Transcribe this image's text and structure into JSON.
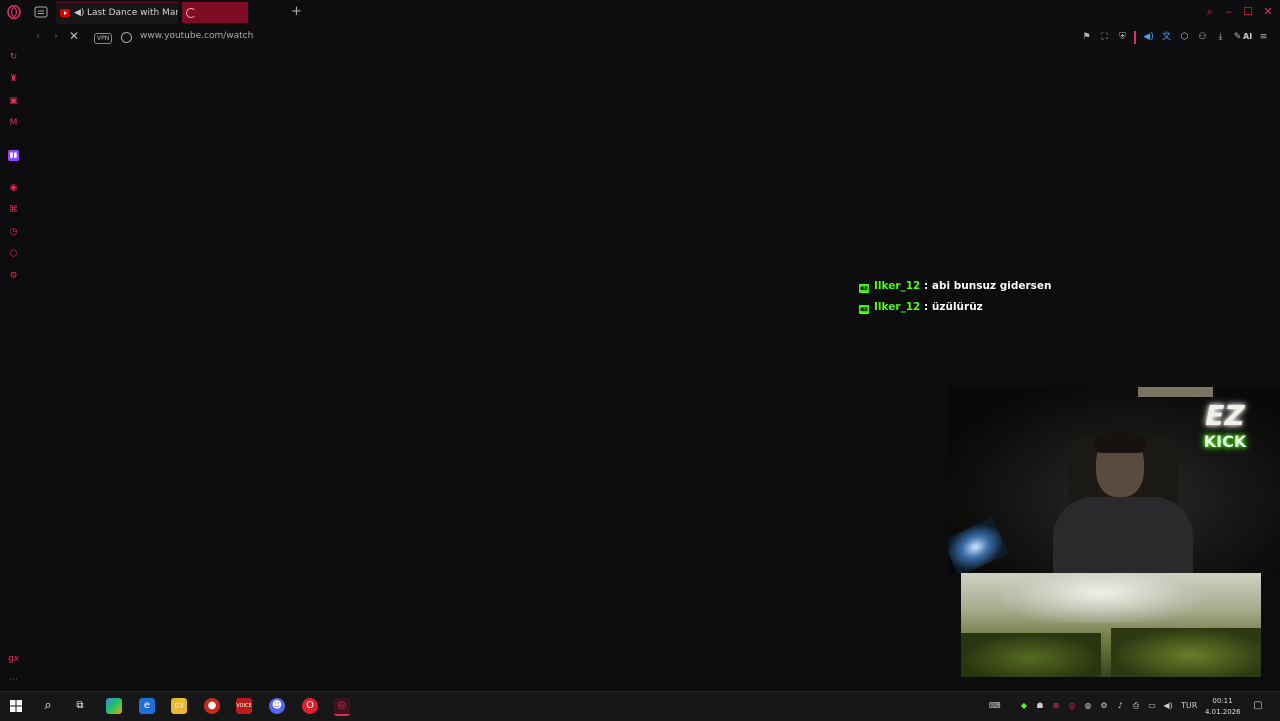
{
  "browser": {
    "tabs": [
      {
        "title": "Last Dance with Mary"
      },
      {
        "title": ""
      }
    ],
    "address": {
      "vpn_label": "VPN",
      "url": "www.youtube.com/watch"
    },
    "toolbar": {
      "ai_label": "AI"
    }
  },
  "overlay": {
    "chat": [
      {
        "user": "Ilker_12",
        "separator": " :",
        "message": " abi bunsuz gidersen"
      },
      {
        "user": "Ilker_12",
        "separator": " :",
        "message": " üzülürüz"
      }
    ],
    "neon_sign": {
      "ez": "EZ",
      "kick": "KICK"
    }
  },
  "taskbar": {
    "tray": {
      "language": "TUR",
      "time": "00:11",
      "date": "4.01.2026"
    }
  },
  "colors": {
    "accent": "#e0305a",
    "kick_green": "#53fc18",
    "tab_active": "#7e0c24"
  }
}
